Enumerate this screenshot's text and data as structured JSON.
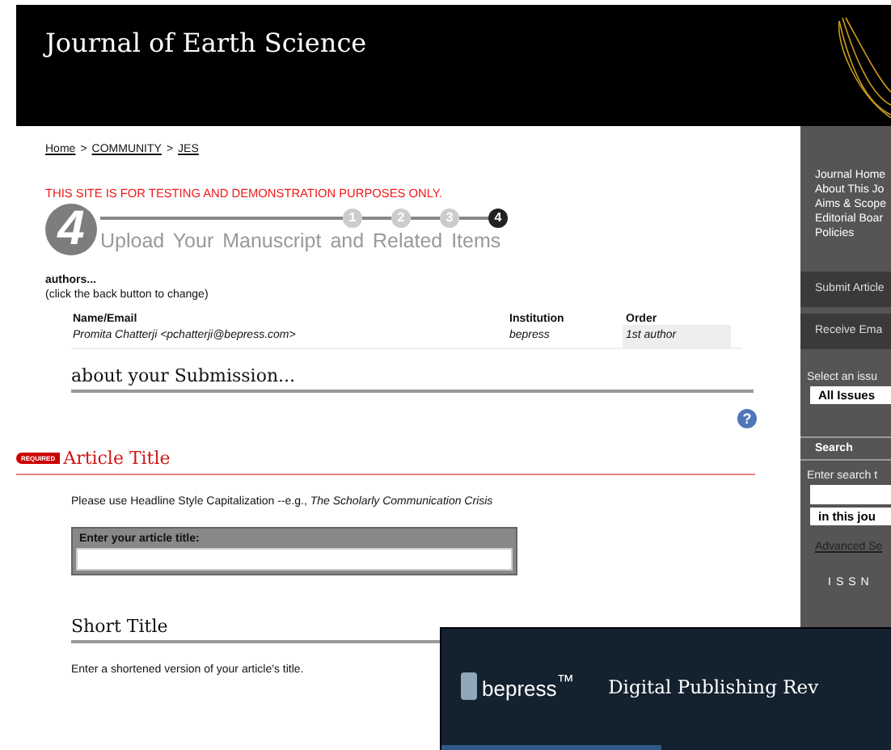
{
  "header": {
    "title": "Journal of Earth Science"
  },
  "breadcrumb": [
    "Home",
    "COMMUNITY",
    "JES"
  ],
  "breadcrumb_separator": ">",
  "notice": "THIS SITE IS FOR TESTING AND DEMONSTRATION PURPOSES ONLY.",
  "progress": {
    "big_number": "4",
    "title": "Upload Your Manuscript and Related Items",
    "steps": [
      {
        "label": "1",
        "current": false
      },
      {
        "label": "2",
        "current": false
      },
      {
        "label": "3",
        "current": false
      },
      {
        "label": "4",
        "current": true
      }
    ]
  },
  "authors": {
    "heading": "authors...",
    "note": "(click the back button to change)",
    "columns": [
      "Name/Email",
      "Institution",
      "Order"
    ],
    "rows": [
      {
        "name_email": "Promita Chatterji <pchatterji@bepress.com>",
        "institution": "bepress",
        "order": "1st author"
      }
    ]
  },
  "about_heading": "about your Submission...",
  "help_icon": "?",
  "article_title": {
    "badge": "REQUIRED",
    "heading": "Article Title",
    "instruction": "Please use Headline Style Capitalization --e.g., *The Scholarly Communication Crisis*",
    "field_label": "Enter your article title:"
  },
  "short_title": {
    "heading": "Short Title",
    "instruction": "Enter a shortened version of your article's title."
  },
  "sidebar": {
    "links": [
      "Journal Home",
      "About This Jo",
      "Aims & Scope",
      "Editorial Boar",
      "Policies"
    ],
    "actions": [
      "Submit Article",
      "Receive Ema"
    ],
    "issue_label": "Select an issu",
    "issue_select": "All Issues",
    "search_heading": "Search",
    "search_label": "Enter search t",
    "search_scope": "in this jou",
    "advanced_link": "Advanced Se",
    "issn": "ISSN"
  },
  "overlay": {
    "logo": "bepress$^{™}$",
    "title": "Digital Publishing Rev"
  }
}
